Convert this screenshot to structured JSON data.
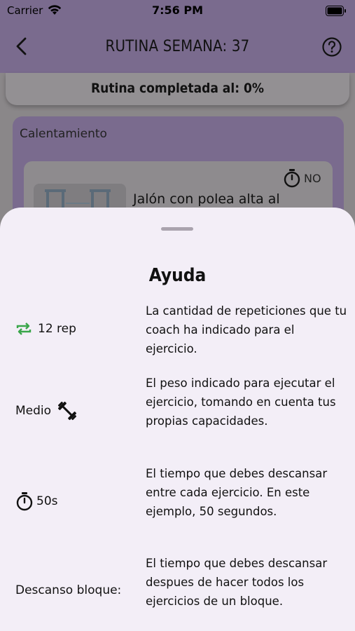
{
  "status_bar": {
    "carrier": "Carrier",
    "time": "7:56 PM",
    "icons": [
      "wifi-icon",
      "battery-icon"
    ]
  },
  "nav": {
    "title": "RUTINA SEMANA: 37",
    "back_icon": "chevron-left-icon",
    "help_icon": "question-circle-icon"
  },
  "progress": {
    "label": "Rutina completada al: 0%"
  },
  "block": {
    "title": "Calentamiento",
    "exercise": {
      "name": "Jalón con polea alta al",
      "rest_flag": "NO",
      "icon": "timer-icon"
    }
  },
  "help_sheet": {
    "title": "Ayuda",
    "rows": [
      {
        "label": "12 rep",
        "icon": "repeat-icon",
        "description": "La cantidad de repeticiones que tu coach ha indicado para el ejercicio."
      },
      {
        "label": "Medio",
        "icon": "dumbbell-icon",
        "description": "El peso indicado para ejecutar el ejercicio, tomando en cuenta tus propias capacidades."
      },
      {
        "label": "50s",
        "icon": "timer-icon",
        "description": "El tiempo que debes descansar entre cada ejercicio. En este ejemplo, 50 segundos."
      },
      {
        "label": "Descanso bloque:",
        "icon": "",
        "description": "El tiempo que debes descansar despues de hacer todos los ejercicios de un bloque."
      }
    ]
  },
  "colors": {
    "header": "#7a6b8e",
    "sheet": "#f3eef7",
    "repeat_icon": "#3aa64a"
  }
}
